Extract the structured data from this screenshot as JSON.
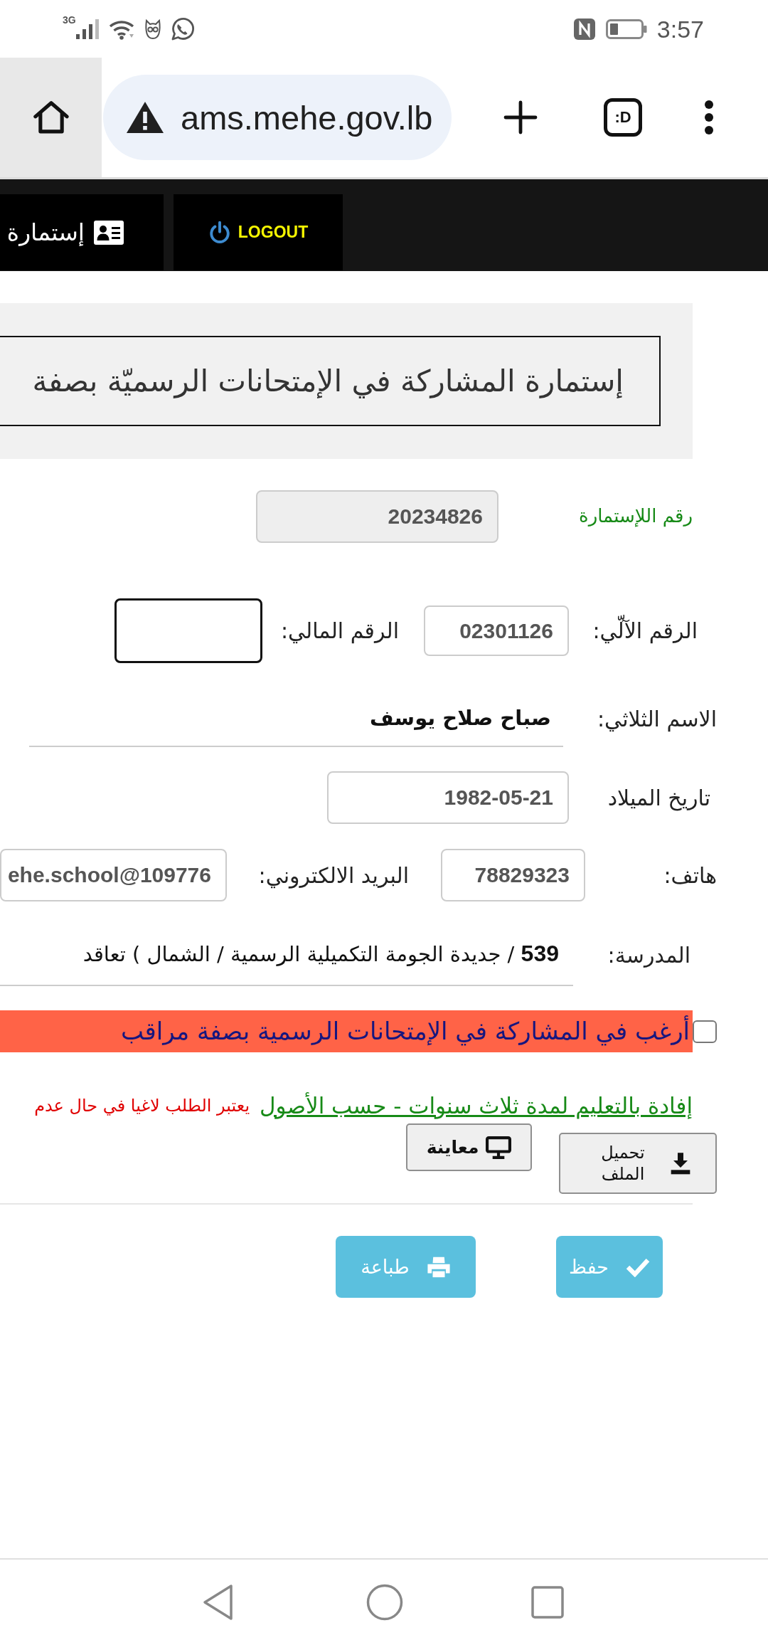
{
  "status_bar": {
    "network_type": "3G",
    "time": "3:57"
  },
  "browser": {
    "url": "ams.mehe.gov.lb",
    "tab_count": ":D"
  },
  "nav": {
    "items": [
      {
        "kind": "logout",
        "label": "LOGOUT"
      },
      {
        "kind": "form",
        "label": "إستمارة"
      }
    ]
  },
  "form": {
    "title": "إستمارة المشاركة في الإمتحانات الرسميّة بصفة",
    "form_number": {
      "label": "رقم اللإستمارة",
      "value": "20234826",
      "disabled": true
    },
    "rows": [
      {
        "fields": [
          {
            "kind": "input",
            "label": "الرقم الآلّي:",
            "value": "02301126",
            "disabled": false,
            "focused": false
          },
          {
            "kind": "input",
            "label": "الرقم المالي:",
            "disabled": false,
            "focused": true
          }
        ]
      },
      {
        "fields": [
          {
            "kind": "text",
            "label": "الاسم الثلاثي:",
            "value": "صباح صلاح يوسف"
          }
        ]
      },
      {
        "fields": [
          {
            "kind": "input",
            "label": "تاريخ الميلاد",
            "value": "1982-05-21",
            "disabled": false,
            "focused": false
          }
        ]
      },
      {
        "fields": [
          {
            "kind": "input",
            "label": "هاتف:",
            "value": "78829323",
            "disabled": false,
            "focused": false
          },
          {
            "kind": "input",
            "label": "البريد الالكتروني:",
            "value": "ehe.school@109776",
            "disabled": false,
            "focused": false
          }
        ]
      },
      {
        "fields": [
          {
            "kind": "text",
            "label": "المدرسة:",
            "value": "**539** / جديدة الجومة التكميلية الرسمية / الشمال ) تعاقد"
          }
        ]
      }
    ],
    "observer_opt_in": {
      "label": "أرغب في المشاركة في الإمتحانات الرسمية بصفة مراقب",
      "checked": false
    },
    "attachment": {
      "link": "إفادة بالتعليم لمدة ثلاث سنوات - حسب الأصول",
      "note": "يعتبر الطلب لاغيا في حال عدم",
      "buttons": [
        {
          "kind": "upload",
          "label": "تحميل الملف"
        },
        {
          "kind": "preview",
          "label": "معاينة"
        }
      ]
    }
  },
  "actions": [
    {
      "kind": "save",
      "label": "حفظ"
    },
    {
      "kind": "print",
      "label": "طباعة"
    }
  ]
}
